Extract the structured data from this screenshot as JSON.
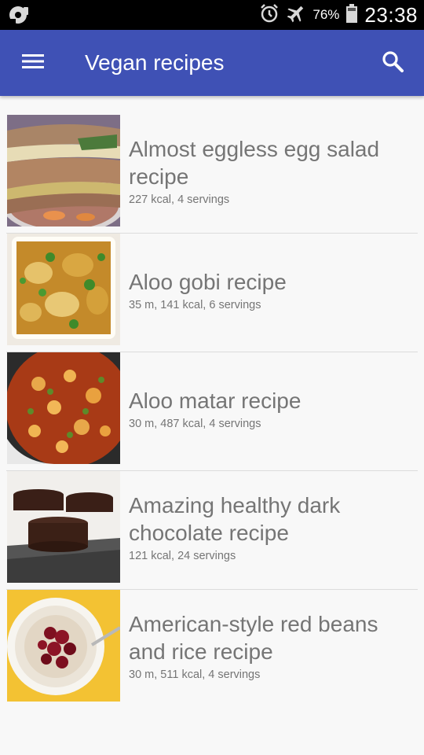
{
  "status_bar": {
    "icons": [
      "media-icon",
      "alarm-icon",
      "airplane-icon",
      "battery-icon"
    ],
    "battery": "76%",
    "time": "23:38"
  },
  "app_bar": {
    "title": "Vegan recipes",
    "color": "#3f51b5",
    "icons": [
      "menu-icon",
      "search-icon"
    ]
  },
  "recipes": [
    {
      "title": "Almost eggless egg salad recipe",
      "meta": "227 kcal, 4 servings"
    },
    {
      "title": "Aloo gobi recipe",
      "meta": "35 m, 141 kcal, 6 servings"
    },
    {
      "title": "Aloo matar recipe",
      "meta": "30 m, 487 kcal, 4 servings"
    },
    {
      "title": "Amazing healthy dark chocolate recipe",
      "meta": "121 kcal, 24 servings"
    },
    {
      "title": "American-style red beans and rice recipe",
      "meta": "30 m, 511 kcal, 4 servings"
    }
  ]
}
